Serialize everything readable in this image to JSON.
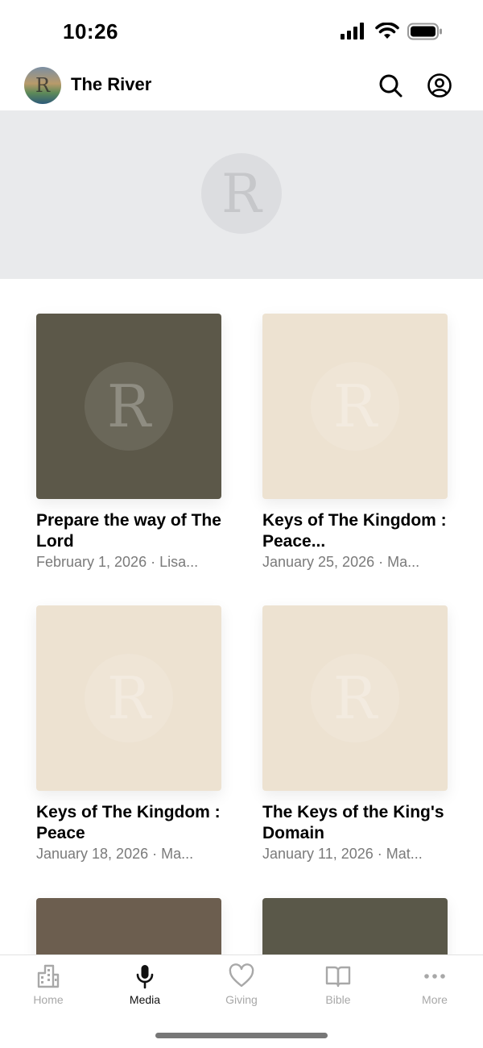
{
  "status_bar": {
    "time": "10:26",
    "icons": [
      "cellular-signal-icon",
      "wifi-icon",
      "battery-icon"
    ]
  },
  "header": {
    "title": "The River",
    "avatar_letter": "R",
    "icons": [
      "search-icon",
      "account-icon"
    ]
  },
  "hero": {
    "logo_letter": "R"
  },
  "media": {
    "logo_letter": "R",
    "items": [
      {
        "title": "Prepare the way of The Lord",
        "meta": "February 1, 2026 · Lisa..."
      },
      {
        "title": "Keys of The Kingdom : Peace...",
        "meta": "January 25, 2026 · Ma..."
      },
      {
        "title": "Keys of The Kingdom : Peace",
        "meta": "January 18, 2026 · Ma..."
      },
      {
        "title": "The Keys of the King's Domain",
        "meta": "January 11, 2026 · Mat..."
      }
    ]
  },
  "tab_bar": {
    "tabs": [
      {
        "label": "Home",
        "icon": "building-icon",
        "active": false
      },
      {
        "label": "Media",
        "icon": "microphone-icon",
        "active": true
      },
      {
        "label": "Giving",
        "icon": "heart-icon",
        "active": false
      },
      {
        "label": "Bible",
        "icon": "book-icon",
        "active": false
      },
      {
        "label": "More",
        "icon": "more-dots-icon",
        "active": false
      }
    ]
  },
  "colors": {
    "accent": "#000000",
    "inactive_tab": "#a8a8a8",
    "hero_bg": "#e9eaec",
    "thumb_dark": "#5c5849",
    "thumb_cream": "#ede2d1"
  }
}
